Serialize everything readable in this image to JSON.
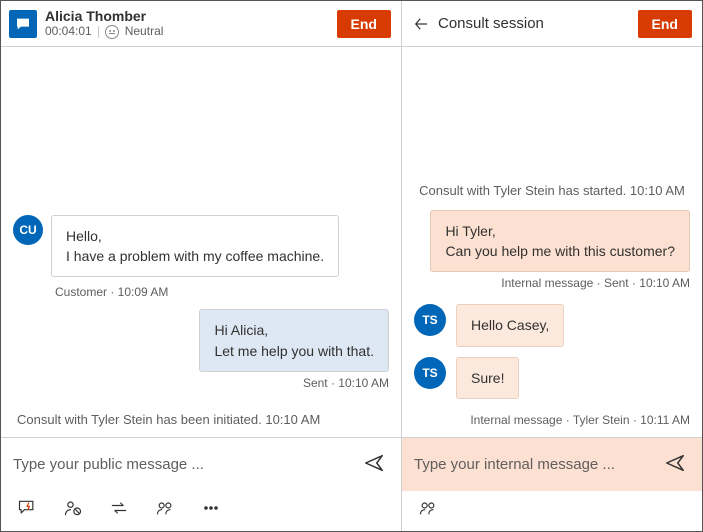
{
  "left": {
    "customer_name": "Alicia Thomber",
    "timer": "00:04:01",
    "sentiment_label": "Neutral",
    "end_label": "End",
    "messages": {
      "customer_initials": "CU",
      "customer_text": "Hello,\nI have a problem with my coffee machine.",
      "customer_meta": "Customer · 10:09 AM",
      "agent_text": "Hi Alicia,\nLet me help you with that.",
      "agent_meta": "Sent · 10:10 AM",
      "system_consult_initiated": "Consult with Tyler Stein has been initiated. 10:10 AM"
    },
    "composer_placeholder": "Type your public message ..."
  },
  "right": {
    "title": "Consult session",
    "end_label": "End",
    "system_started": "Consult with Tyler Stein has started. 10:10 AM",
    "agent_out_text": "Hi Tyler,\nCan you help me with this customer?",
    "agent_out_meta": "Internal message · Sent · 10:10 AM",
    "ts_initials": "TS",
    "ts_msg1": "Hello Casey,",
    "ts_msg2": "Sure!",
    "ts_meta": "Internal message · Tyler Stein · 10:11 AM",
    "composer_placeholder": "Type your internal message ..."
  }
}
